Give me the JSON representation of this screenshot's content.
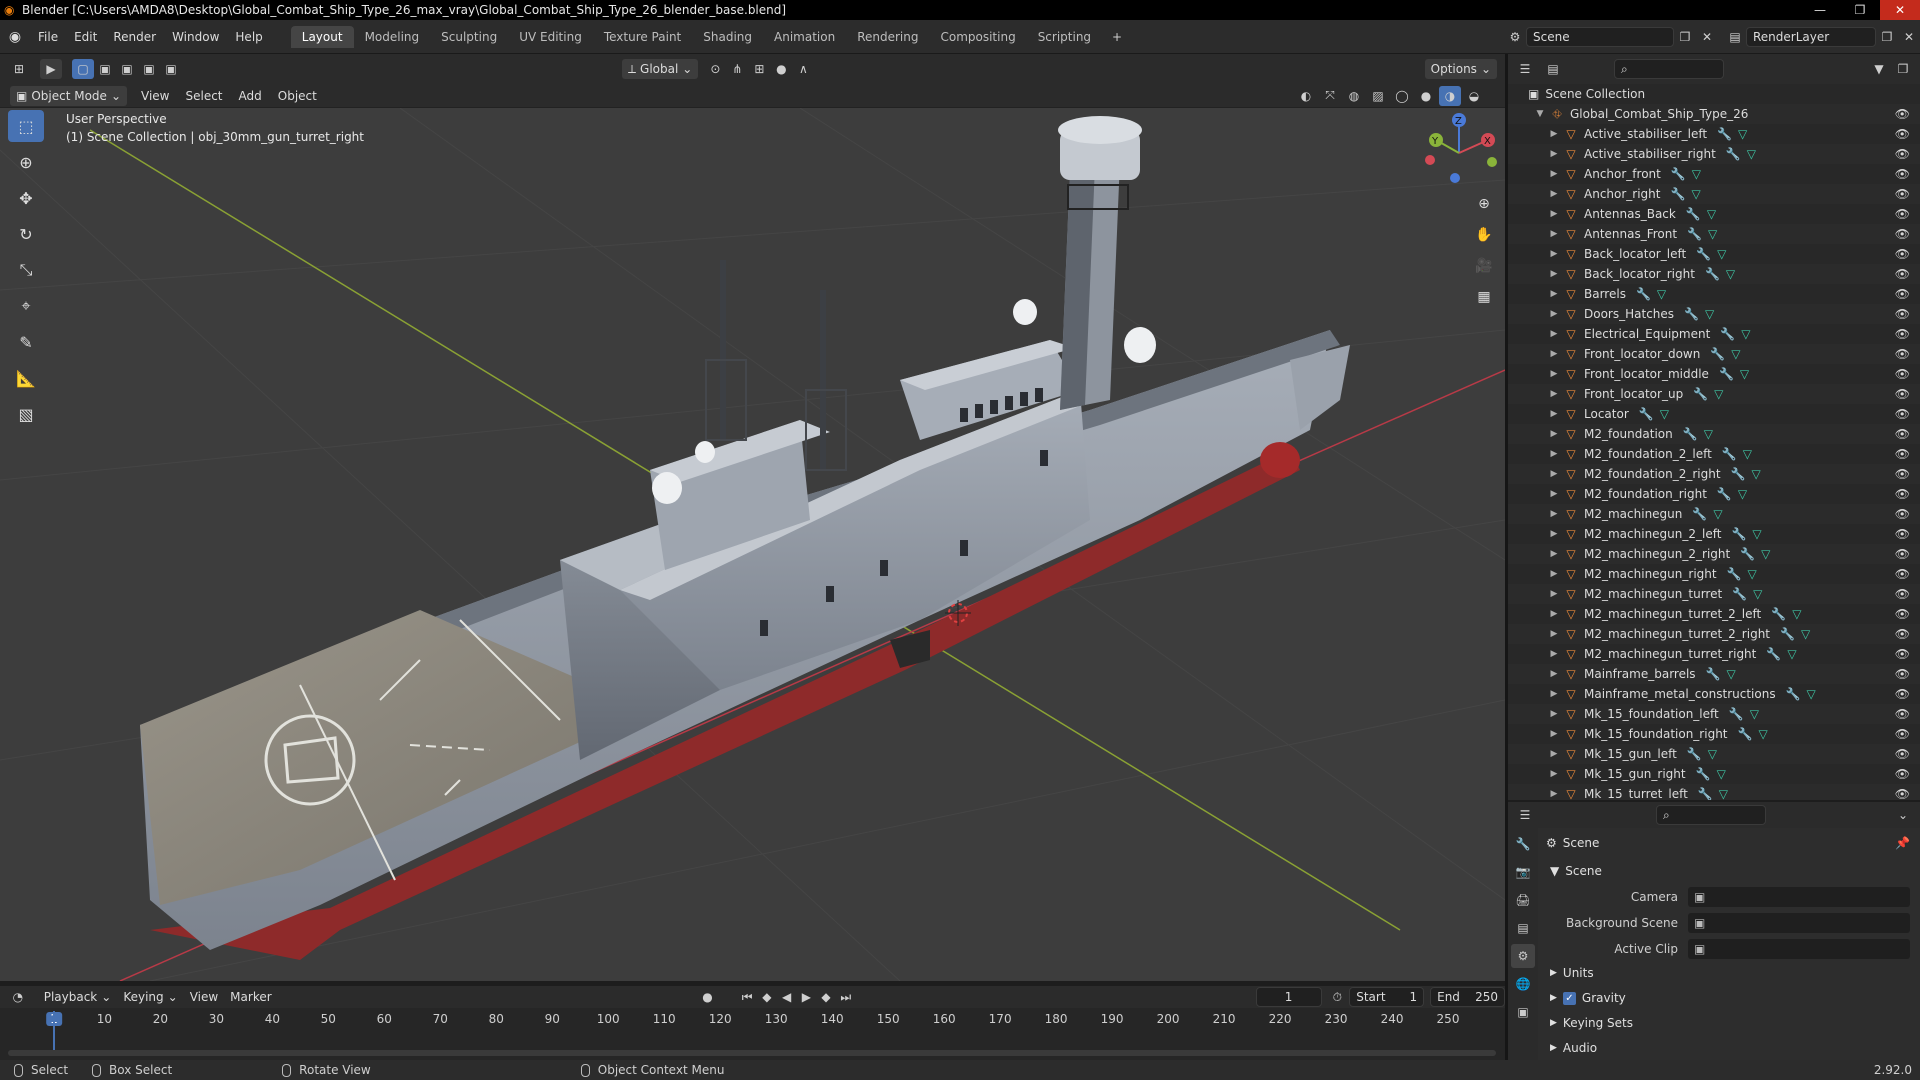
{
  "window": {
    "title": "Blender [C:\\Users\\AMDA8\\Desktop\\Global_Combat_Ship_Type_26_max_vray\\Global_Combat_Ship_Type_26_blender_base.blend]",
    "minimize": "—",
    "maximize": "❐",
    "close": "✕"
  },
  "menu": [
    "File",
    "Edit",
    "Render",
    "Window",
    "Help"
  ],
  "workspaces": [
    "Layout",
    "Modeling",
    "Sculpting",
    "UV Editing",
    "Texture Paint",
    "Shading",
    "Animation",
    "Rendering",
    "Compositing",
    "Scripting"
  ],
  "active_workspace": "Layout",
  "scene_selector": {
    "scene": "Scene",
    "render_layer": "RenderLayer"
  },
  "viewport_header": {
    "transform_orientation": "Global",
    "options_label": "Options",
    "mode": "Object Mode",
    "menus": [
      "View",
      "Select",
      "Add",
      "Object"
    ]
  },
  "viewport": {
    "perspective": "User Perspective",
    "collection_info": "(1) Scene Collection | obj_30mm_gun_turret_right",
    "gizmo_axes": {
      "x": "X",
      "y": "Y",
      "z": "Z"
    },
    "colors": {
      "background": "#3d3d3d",
      "grid": "#464646",
      "x_axis": "#b83a47",
      "y_axis": "#8aa134",
      "hull": "#8f96a0",
      "deck": "#8a857b",
      "waterline": "#a52a2a"
    }
  },
  "tools": [
    "select-box",
    "cursor",
    "move",
    "rotate",
    "scale",
    "transform",
    "annotate",
    "measure",
    "add-cube"
  ],
  "outliner": {
    "root": "Scene Collection",
    "collection": "Global_Combat_Ship_Type_26",
    "items": [
      "Active_stabiliser_left",
      "Active_stabiliser_right",
      "Anchor_front",
      "Anchor_right",
      "Antennas_Back",
      "Antennas_Front",
      "Back_locator_left",
      "Back_locator_right",
      "Barrels",
      "Doors_Hatches",
      "Electrical_Equipment",
      "Front_locator_down",
      "Front_locator_middle",
      "Front_locator_up",
      "Locator",
      "M2_foundation",
      "M2_foundation_2_left",
      "M2_foundation_2_right",
      "M2_foundation_right",
      "M2_machinegun",
      "M2_machinegun_2_left",
      "M2_machinegun_2_right",
      "M2_machinegun_right",
      "M2_machinegun_turret",
      "M2_machinegun_turret_2_left",
      "M2_machinegun_turret_2_right",
      "M2_machinegun_turret_right",
      "Mainframe_barrels",
      "Mainframe_metal_constructions",
      "Mk_15_foundation_left",
      "Mk_15_foundation_right",
      "Mk_15_gun_left",
      "Mk_15_gun_right",
      "Mk_15_turret_left"
    ]
  },
  "properties": {
    "context": "Scene",
    "panel": "Scene",
    "fields": [
      {
        "label": "Camera",
        "value": ""
      },
      {
        "label": "Background Scene",
        "value": ""
      },
      {
        "label": "Active Clip",
        "value": ""
      }
    ],
    "subpanels": [
      "Units",
      "Gravity",
      "Keying Sets",
      "Audio"
    ]
  },
  "timeline": {
    "menus": [
      "Playback",
      "Keying",
      "View",
      "Marker"
    ],
    "current_frame": "1",
    "start_label": "Start",
    "start": "1",
    "end_label": "End",
    "end": "250",
    "ticks": [
      "1",
      "10",
      "20",
      "30",
      "40",
      "50",
      "60",
      "70",
      "80",
      "90",
      "100",
      "110",
      "120",
      "130",
      "140",
      "150",
      "160",
      "170",
      "180",
      "190",
      "200",
      "210",
      "220",
      "230",
      "240",
      "250"
    ]
  },
  "statusbar": {
    "select": "Select",
    "box_select": "Box Select",
    "rotate_view": "Rotate View",
    "context_menu": "Object Context Menu",
    "version": "2.92.0"
  }
}
